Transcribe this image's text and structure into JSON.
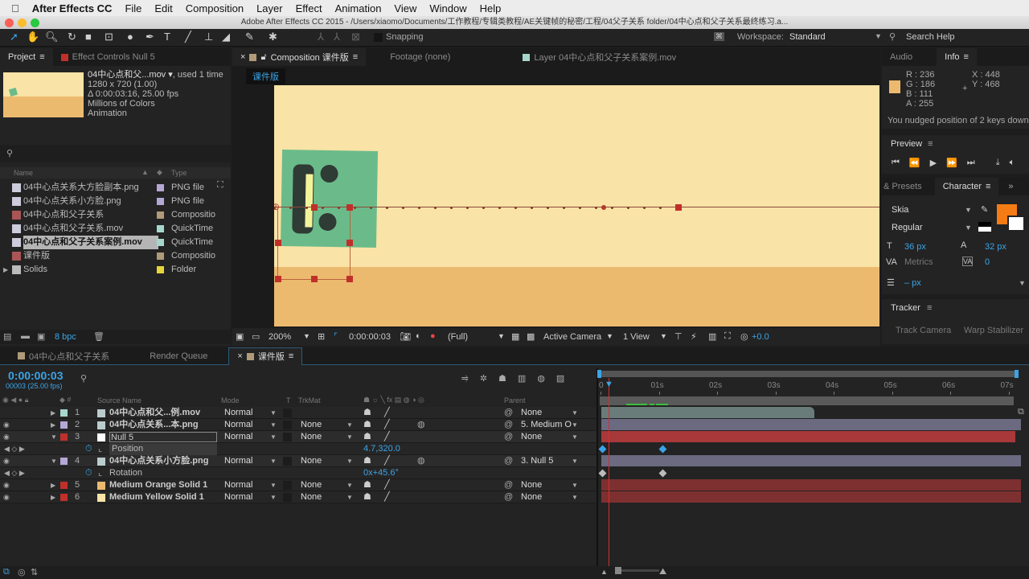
{
  "menubar": {
    "app": "After Effects CC",
    "items": [
      "File",
      "Edit",
      "Composition",
      "Layer",
      "Effect",
      "Animation",
      "View",
      "Window",
      "Help"
    ]
  },
  "window_title": "Adobe After Effects CC 2015 - /Users/xiaomo/Documents/工作教程/专辑类教程/AE关键帧的秘密/工程/04父子关系 folder/04中心点和父子关系最终练习.a...",
  "toolbar": {
    "snapping": "Snapping",
    "workspace_label": "Workspace:",
    "workspace_value": "Standard",
    "search_help": "Search Help"
  },
  "project": {
    "tabs": [
      "Project",
      "Effect Controls Null 5"
    ],
    "preview": {
      "name": "04中心点和父...mov ▾",
      "used": ", used 1 time",
      "dims": "1280 x 720 (1.00)",
      "duration": "Δ 0:00:03:16, 25.00 fps",
      "colors": "Millions of Colors",
      "codec": "Animation"
    },
    "columns": {
      "name": "Name",
      "type": "Type"
    },
    "items": [
      {
        "name": "04中心点关系大方脸副本.png",
        "type": "PNG file",
        "color": "#b4a7d6"
      },
      {
        "name": "04中心点关系小方脸.png",
        "type": "PNG file",
        "color": "#b4a7d6"
      },
      {
        "name": "04中心点和父子关系",
        "type": "Compositio",
        "color": "#b19a78"
      },
      {
        "name": "04中心点和父子关系.mov",
        "type": "QuickTime",
        "color": "#a6d6cc"
      },
      {
        "name": "04中心点和父子关系案例.mov",
        "type": "QuickTime",
        "color": "#a6d6cc",
        "selected": true
      },
      {
        "name": "课件版",
        "type": "Compositio",
        "color": "#b19a78"
      },
      {
        "name": "Solids",
        "type": "Folder",
        "color": "#e6d63a"
      }
    ],
    "bpc": "8 bpc"
  },
  "composition": {
    "tabs": [
      "Composition 课件版",
      "Footage (none)",
      "Layer 04中心点和父子关系案例.mov"
    ],
    "breadcrumb": "课件版",
    "footer": {
      "zoom": "200%",
      "time": "0:00:00:03",
      "resolution": "(Full)",
      "camera": "Active Camera",
      "view": "1 View",
      "exposure": "+0.0"
    },
    "colors": {
      "top": "#f9e3a6",
      "bottom": "#ecba6f",
      "face": "#6bbb8a"
    }
  },
  "info": {
    "tabs": [
      "Audio",
      "Info"
    ],
    "r": "R : 236",
    "g": "G : 186",
    "b": "B : 111",
    "a": "A : 255",
    "x": "X : 448",
    "y": "Y : 468",
    "swatch": "#ecba6f",
    "message": "You nudged position of 2 keys down"
  },
  "preview_panel": {
    "title": "Preview"
  },
  "character": {
    "tabs": [
      "& Presets",
      "Character"
    ],
    "font": "Skia",
    "style": "Regular",
    "size": "36 px",
    "leading": "32 px",
    "kerning": "Metrics",
    "tracking": "0",
    "stroke": "– px",
    "fill_color": "#f57c14"
  },
  "tracker": {
    "title": "Tracker",
    "track_camera": "Track Camera",
    "warp": "Warp Stabilizer"
  },
  "timeline": {
    "tabs": [
      "04中心点和父子关系",
      "Render Queue",
      "课件版"
    ],
    "timecode": "0:00:00:03",
    "frames": "00003 (25.00 fps)",
    "columns": {
      "source": "Source Name",
      "mode": "Mode",
      "t": "T",
      "trkmat": "TrkMat",
      "parent": "Parent"
    },
    "ruler": [
      "0",
      "01s",
      "02s",
      "03s",
      "04s",
      "05s",
      "06s",
      "07s"
    ],
    "layers": [
      {
        "num": "1",
        "name": "04中心点和父...例.mov",
        "mode": "Normal",
        "trkmat": "",
        "parent": "None",
        "label": "#a6d6cc",
        "icon": "movie",
        "bar_end": 3.65,
        "bar_color": "#6a7c7a"
      },
      {
        "num": "2",
        "name": "04中心点关系...本.png",
        "mode": "Normal",
        "trkmat": "None",
        "parent": "5. Medium O",
        "label": "#b4a7d6",
        "icon": "image",
        "bar_end": 7.2,
        "bar_color": "#6b6a80"
      },
      {
        "num": "3",
        "name": "Null 5",
        "mode": "Normal",
        "trkmat": "None",
        "parent": "None",
        "label": "#c0302a",
        "icon": "null",
        "bar_end": 7.1,
        "bar_color": "#a8393a",
        "expanded": true,
        "prop": {
          "name": "Position",
          "value": "4.7,320.0",
          "keys": [
            0,
            1.04
          ]
        }
      },
      {
        "num": "4",
        "name": "04中心点关系小方脸.png",
        "mode": "Normal",
        "trkmat": "None",
        "parent": "3. Null 5",
        "label": "#b4a7d6",
        "icon": "image",
        "bar_end": 7.2,
        "bar_color": "#6b6a80",
        "expanded": true,
        "prop": {
          "name": "Rotation",
          "value": "0x+45.6°",
          "keys": [
            0,
            1.04
          ]
        }
      },
      {
        "num": "5",
        "name": "Medium Orange Solid 1",
        "mode": "Normal",
        "trkmat": "None",
        "parent": "None",
        "label": "#c0302a",
        "icon": "solid-orange",
        "bar_end": 7.2,
        "bar_color": "#7e3030"
      },
      {
        "num": "6",
        "name": "Medium Yellow Solid 1",
        "mode": "Normal",
        "trkmat": "None",
        "parent": "None",
        "label": "#c0302a",
        "icon": "solid-yellow",
        "bar_end": 7.2,
        "bar_color": "#7e3030"
      }
    ]
  }
}
